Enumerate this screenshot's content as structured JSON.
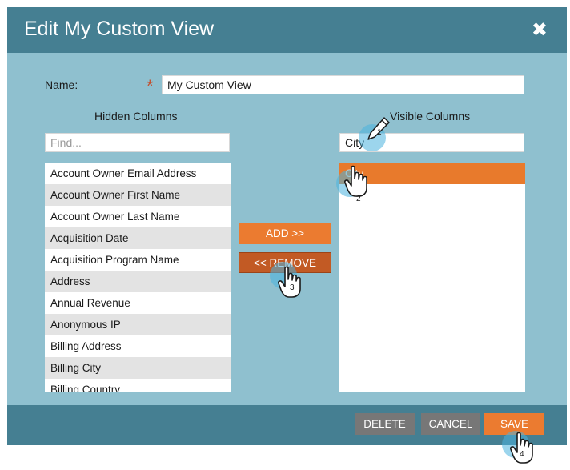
{
  "dialog": {
    "title": "Edit My Custom View",
    "close_glyph": "✖"
  },
  "form": {
    "name_label": "Name:",
    "required_mark": "*",
    "name_value": "My Custom View"
  },
  "hidden_columns": {
    "heading": "Hidden Columns",
    "find_placeholder": "Find...",
    "find_value": "",
    "items": [
      "Account Owner Email Address",
      "Account Owner First Name",
      "Account Owner Last Name",
      "Acquisition Date",
      "Acquisition Program Name",
      "Address",
      "Annual Revenue",
      "Anonymous IP",
      "Billing Address",
      "Billing City",
      "Billing Country"
    ]
  },
  "visible_columns": {
    "heading": "Visible Columns",
    "find_value": "City",
    "items": [
      "City"
    ]
  },
  "actions": {
    "add_label": "ADD >>",
    "remove_label": "<< REMOVE"
  },
  "footer": {
    "delete_label": "DELETE",
    "cancel_label": "CANCEL",
    "save_label": "SAVE"
  },
  "step_markers": [
    "1",
    "2",
    "3",
    "4"
  ],
  "colors": {
    "header": "#457f92",
    "body": "#8fc0cf",
    "accent": "#eb7b30",
    "accent_dark": "#c25a24",
    "neutral_button": "#777777",
    "marker": "#4bb2de"
  },
  "icons": [
    "close-icon",
    "pencil-icon",
    "hand-cursor-icon"
  ]
}
